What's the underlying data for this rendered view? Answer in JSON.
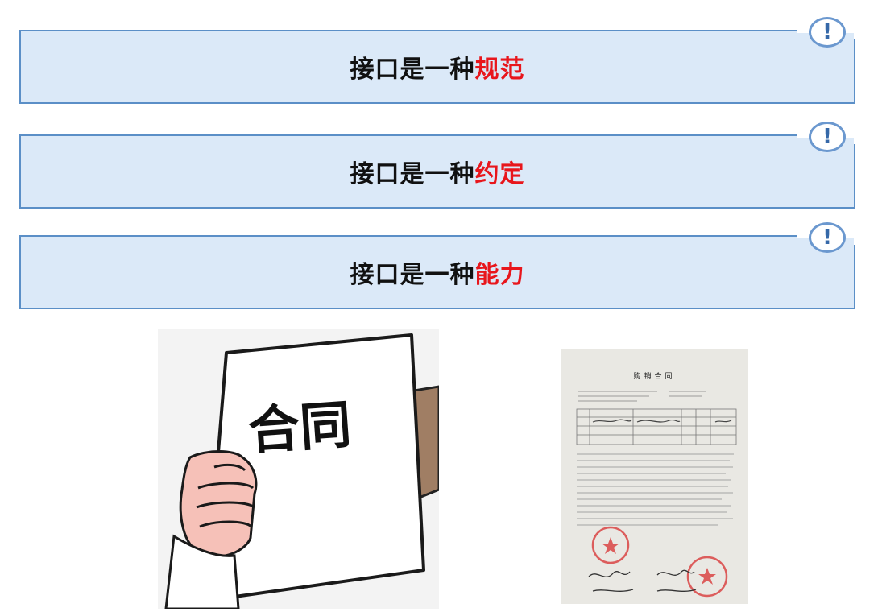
{
  "banners": [
    {
      "prefix": "接口是一种",
      "highlight": "规范"
    },
    {
      "prefix": "接口是一种",
      "highlight": "约定"
    },
    {
      "prefix": "接口是一种",
      "highlight": "能力"
    }
  ],
  "alert_glyph": "!",
  "colors": {
    "banner_bg": "#dbe9f8",
    "banner_border": "#5b8fc7",
    "highlight": "#e8161c",
    "alert": "#3568a8"
  },
  "icons": [
    "exclamation-icon"
  ],
  "cartoon": {
    "paper_text": "合同"
  },
  "photo": {
    "doc_title": "购销合同"
  }
}
